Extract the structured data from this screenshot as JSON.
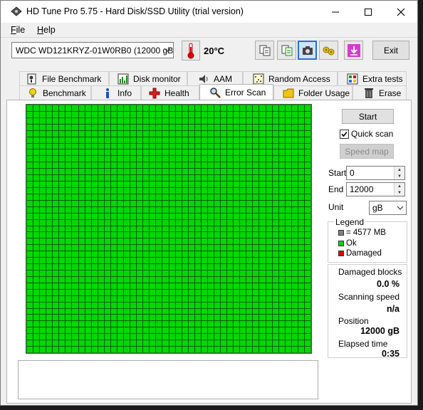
{
  "window": {
    "title": "HD Tune Pro 5.75 - Hard Disk/SSD Utility (trial version)"
  },
  "menu": {
    "file": "File",
    "file_key": "F",
    "file_rest": "ile",
    "help_key": "H",
    "help_rest": "elp"
  },
  "toolbar": {
    "drive": "WDC WD121KRYZ-01W0RB0 (12000 gB",
    "temperature": "20°C",
    "buttons": [
      "copy-icon",
      "save-icon",
      "screenshot-icon",
      "options-icon",
      "download-icon"
    ],
    "exit_label": "Exit"
  },
  "tabs": {
    "row1": [
      "File Benchmark",
      "Disk monitor",
      "AAM",
      "Random Access",
      "Extra tests"
    ],
    "row2": [
      "Benchmark",
      "Info",
      "Health",
      "Error Scan",
      "Folder Usage",
      "Erase"
    ],
    "active": "Error Scan"
  },
  "scan": {
    "start_button": "Start",
    "quick_scan_label": "Quick scan",
    "quick_scan_checked": true,
    "speed_map_button": "Speed map",
    "start_label": "Start",
    "start_value": "0",
    "end_label": "End",
    "end_value": "12000",
    "unit_label": "Unit",
    "unit_value": "gB",
    "grid_cols": 44,
    "grid_rows": 39
  },
  "legend": {
    "title": "Legend",
    "block_size": "= 4577 MB",
    "ok": "Ok",
    "damaged": "Damaged",
    "colors": {
      "block": "#808080",
      "ok": "#00d900",
      "damaged": "#e00000"
    }
  },
  "stats": {
    "damaged_blocks_label": "Damaged blocks",
    "damaged_blocks_value": "0.0 %",
    "scanning_speed_label": "Scanning speed",
    "scanning_speed_value": "n/a",
    "position_label": "Position",
    "position_value": "12000 gB",
    "elapsed_label": "Elapsed time",
    "elapsed_value": "0:35"
  }
}
